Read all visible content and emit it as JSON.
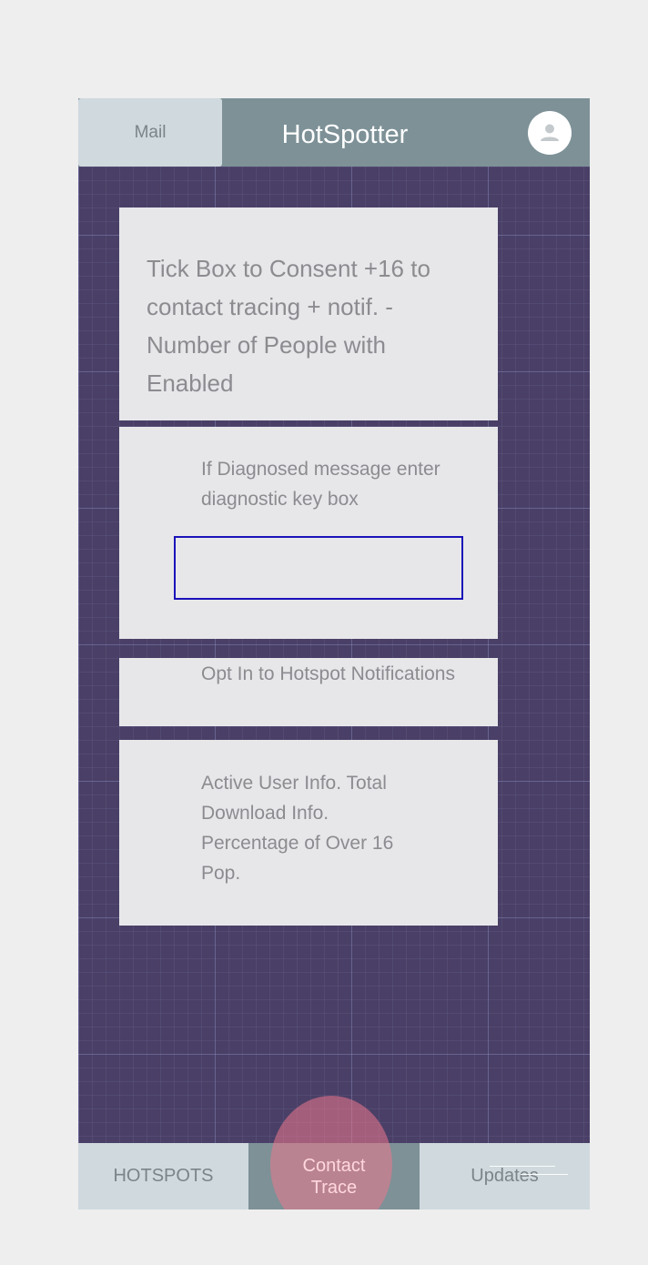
{
  "header": {
    "mail_label": "Mail",
    "title": "HotSpotter",
    "avatar_icon": "person-icon"
  },
  "cards": {
    "consent_text": "Tick Box to Consent +16 to contact tracing + notif. -Number of People with Enabled",
    "diagnosed_text": "If Diagnosed message enter diagnostic key box",
    "diagnostic_key_value": "",
    "optin_text": "Opt In to Hotspot Notifications",
    "active_user_text": "Active User Info. Total Download Info. Percentage of Over 16 Pop."
  },
  "bottom_nav": {
    "hotspots_label": "HOTSPOTS",
    "contact_trace_line1": "Contact",
    "contact_trace_line2": "Trace",
    "updates_label": "Updates"
  },
  "colors": {
    "background": "#4a3f66",
    "header": "#7d9197",
    "tab_light": "#cfd9de",
    "card": "#e7e7ea",
    "input_border": "#1a12b8",
    "touch_highlight": "#ec788c"
  }
}
